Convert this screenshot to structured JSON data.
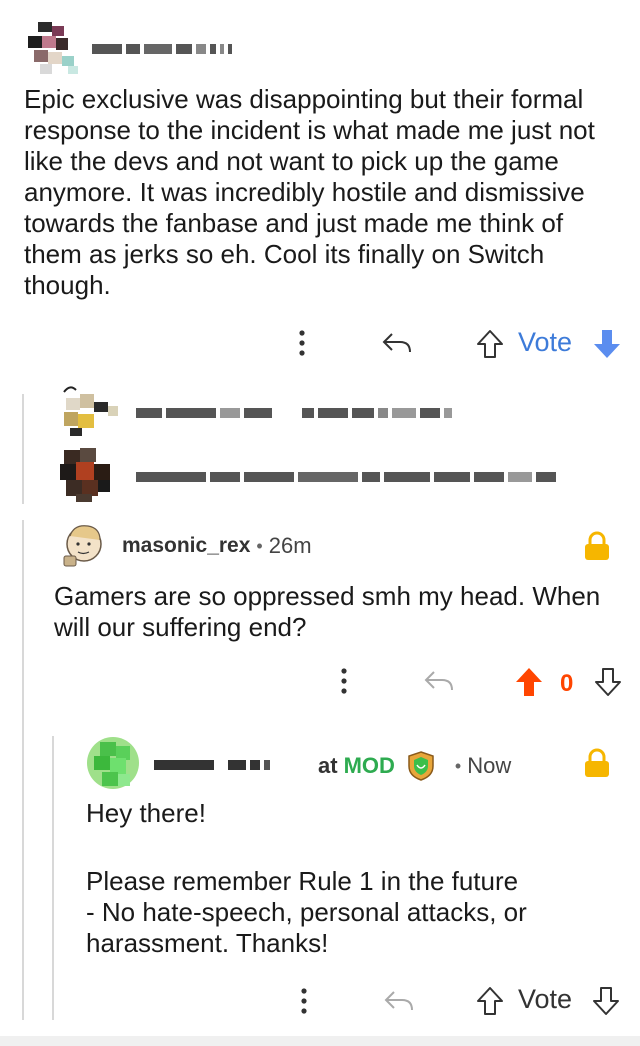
{
  "top_comment": {
    "username": "",
    "body": "Epic exclusive was disappointing but their formal response to the incident is what made me just not like the devs and not want to pick up the game anymore. It was incredibly hostile and dismissive towards the fanbase and just made me think of them as jerks so eh. Cool its finally on Switch though.",
    "actions": {
      "vote_label": "Vote"
    }
  },
  "reply": {
    "username": "masonic_rex",
    "time": "26m",
    "body": "Gamers are so oppressed smh my head. When will our suffering end?",
    "score": "0"
  },
  "mod_reply": {
    "username_visible_suffix": "at",
    "badge": "MOD",
    "time": "Now",
    "greeting": "Hey there!",
    "rule_line": "Please remember Rule 1 in the future",
    "rule_detail": "- No hate-speech, personal attacks, or harassment. Thanks!",
    "actions": {
      "vote_label": "Vote"
    }
  },
  "separator": "•",
  "colors": {
    "upvote_blue": "#5b8def",
    "upvote_orange": "#ff4500",
    "lock_gold": "#f6b600",
    "mod_green": "#2eab50",
    "vote_blue": "#3d7bd9"
  }
}
